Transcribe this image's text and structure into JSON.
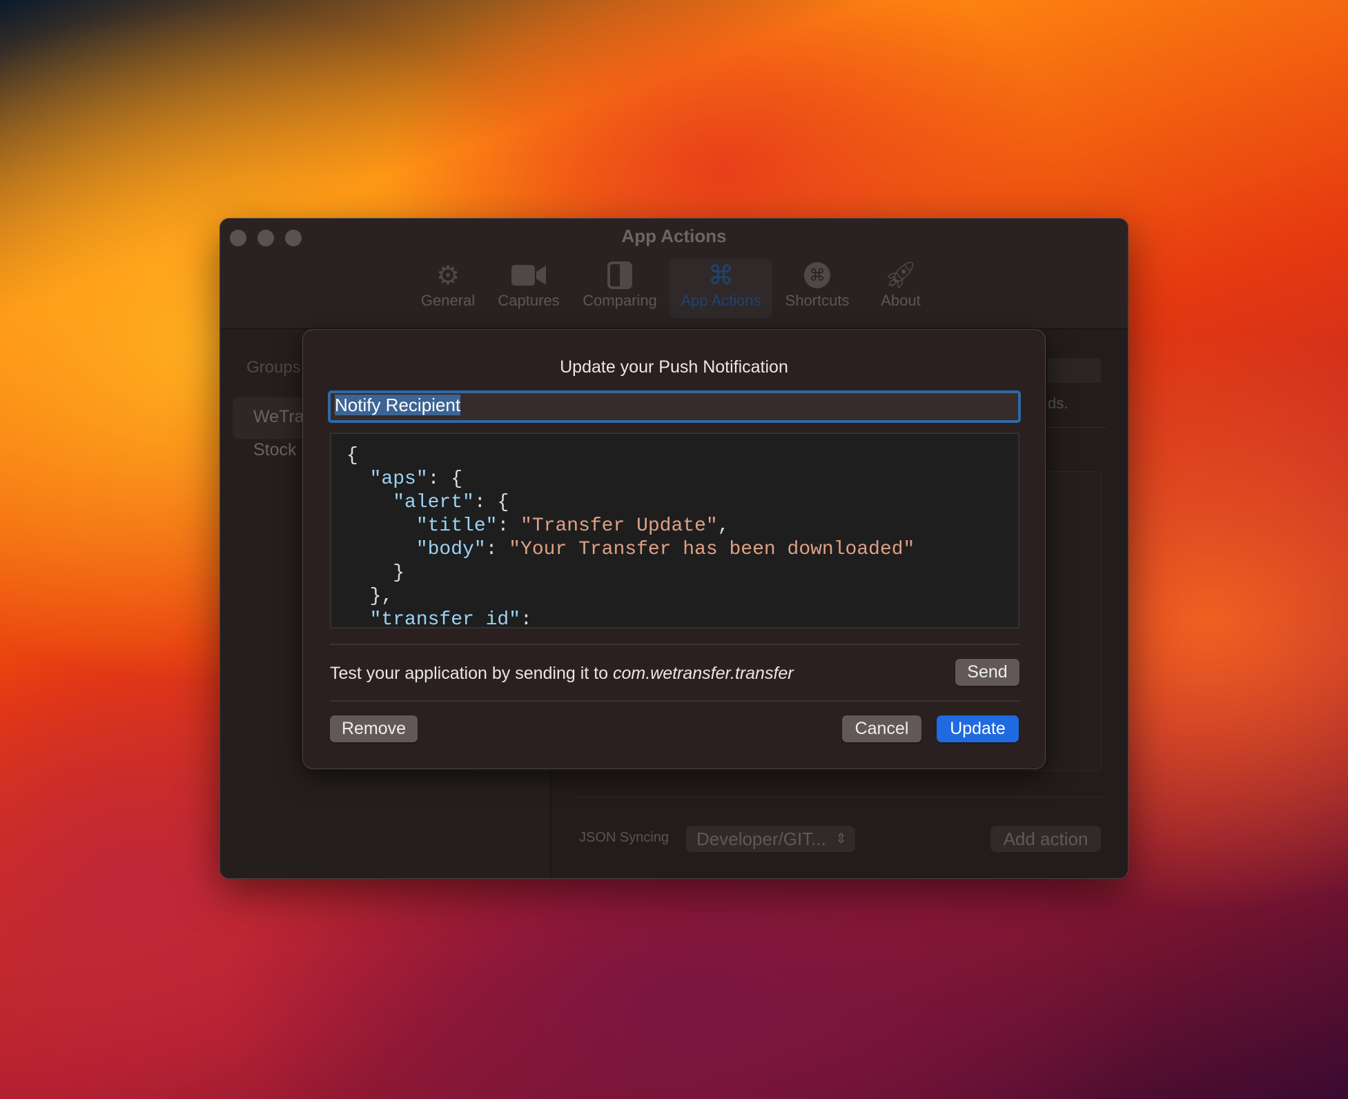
{
  "window": {
    "title": "App Actions"
  },
  "toolbar": {
    "items": [
      {
        "label": "General",
        "icon": "gear-icon",
        "active": false
      },
      {
        "label": "Captures",
        "icon": "video-camera-icon",
        "active": false
      },
      {
        "label": "Comparing",
        "icon": "split-rectangle-icon",
        "active": false
      },
      {
        "label": "App Actions",
        "icon": "command-icon",
        "active": true
      },
      {
        "label": "Shortcuts",
        "icon": "command-circle-icon",
        "active": false
      },
      {
        "label": "About",
        "icon": "rocket-icon",
        "active": false
      }
    ]
  },
  "sidebar": {
    "header": "Groups",
    "items": [
      {
        "label": "WeTra"
      },
      {
        "label": "Stock"
      }
    ]
  },
  "main": {
    "partial_text": "ds.",
    "json_syncing_label": "JSON Syncing",
    "json_syncing_value": "Developer/GIT...",
    "add_action": "Add action"
  },
  "dialog": {
    "title": "Update your Push Notification",
    "name_value": "Notify Recipient",
    "code_lines": [
      [
        {
          "t": "{",
          "c": "p"
        }
      ],
      [
        {
          "t": "  \"aps\"",
          "c": "k"
        },
        {
          "t": ": {",
          "c": "p"
        }
      ],
      [
        {
          "t": "    \"alert\"",
          "c": "k"
        },
        {
          "t": ": {",
          "c": "p"
        }
      ],
      [
        {
          "t": "      \"title\"",
          "c": "k"
        },
        {
          "t": ": ",
          "c": "p"
        },
        {
          "t": "\"Transfer Update\"",
          "c": "s"
        },
        {
          "t": ",",
          "c": "p"
        }
      ],
      [
        {
          "t": "      \"body\"",
          "c": "k"
        },
        {
          "t": ": ",
          "c": "p"
        },
        {
          "t": "\"Your Transfer has been downloaded\"",
          "c": "s"
        }
      ],
      [
        {
          "t": "    }",
          "c": "p"
        }
      ],
      [
        {
          "t": "  },",
          "c": "p"
        }
      ],
      [
        {
          "t": "  \"transfer id\"",
          "c": "k"
        },
        {
          "t": ":",
          "c": "p"
        }
      ]
    ],
    "test_prefix": "Test your application by sending it to ",
    "test_target": "com.wetransfer.transfer",
    "send": "Send",
    "remove": "Remove",
    "cancel": "Cancel",
    "update": "Update"
  },
  "colors": {
    "accent": "#1f6ae0",
    "focus_ring": "#2f69a3",
    "json_key": "#9bd2f5",
    "json_string": "#e0a085"
  }
}
